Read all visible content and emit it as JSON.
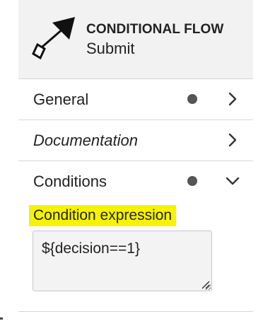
{
  "header": {
    "element_type": "CONDITIONAL FLOW",
    "element_name": "Submit",
    "icon": "conditional-flow-icon"
  },
  "groups": [
    {
      "label": "General",
      "has_entries_dot": true,
      "expanded": false,
      "italic": false,
      "icon": "chevron-right-icon"
    },
    {
      "label": "Documentation",
      "has_entries_dot": false,
      "expanded": false,
      "italic": true,
      "icon": "chevron-right-icon"
    },
    {
      "label": "Conditions",
      "has_entries_dot": true,
      "expanded": true,
      "italic": false,
      "icon": "chevron-down-icon"
    }
  ],
  "conditions": {
    "entry_label": "Condition expression",
    "expression_value": "${decision==1}",
    "label_highlight_color": "#f6f300"
  },
  "colors": {
    "header_background": "#f2f2f2",
    "text": "#222222",
    "divider": "#d6d6d6",
    "dot": "#555555"
  }
}
